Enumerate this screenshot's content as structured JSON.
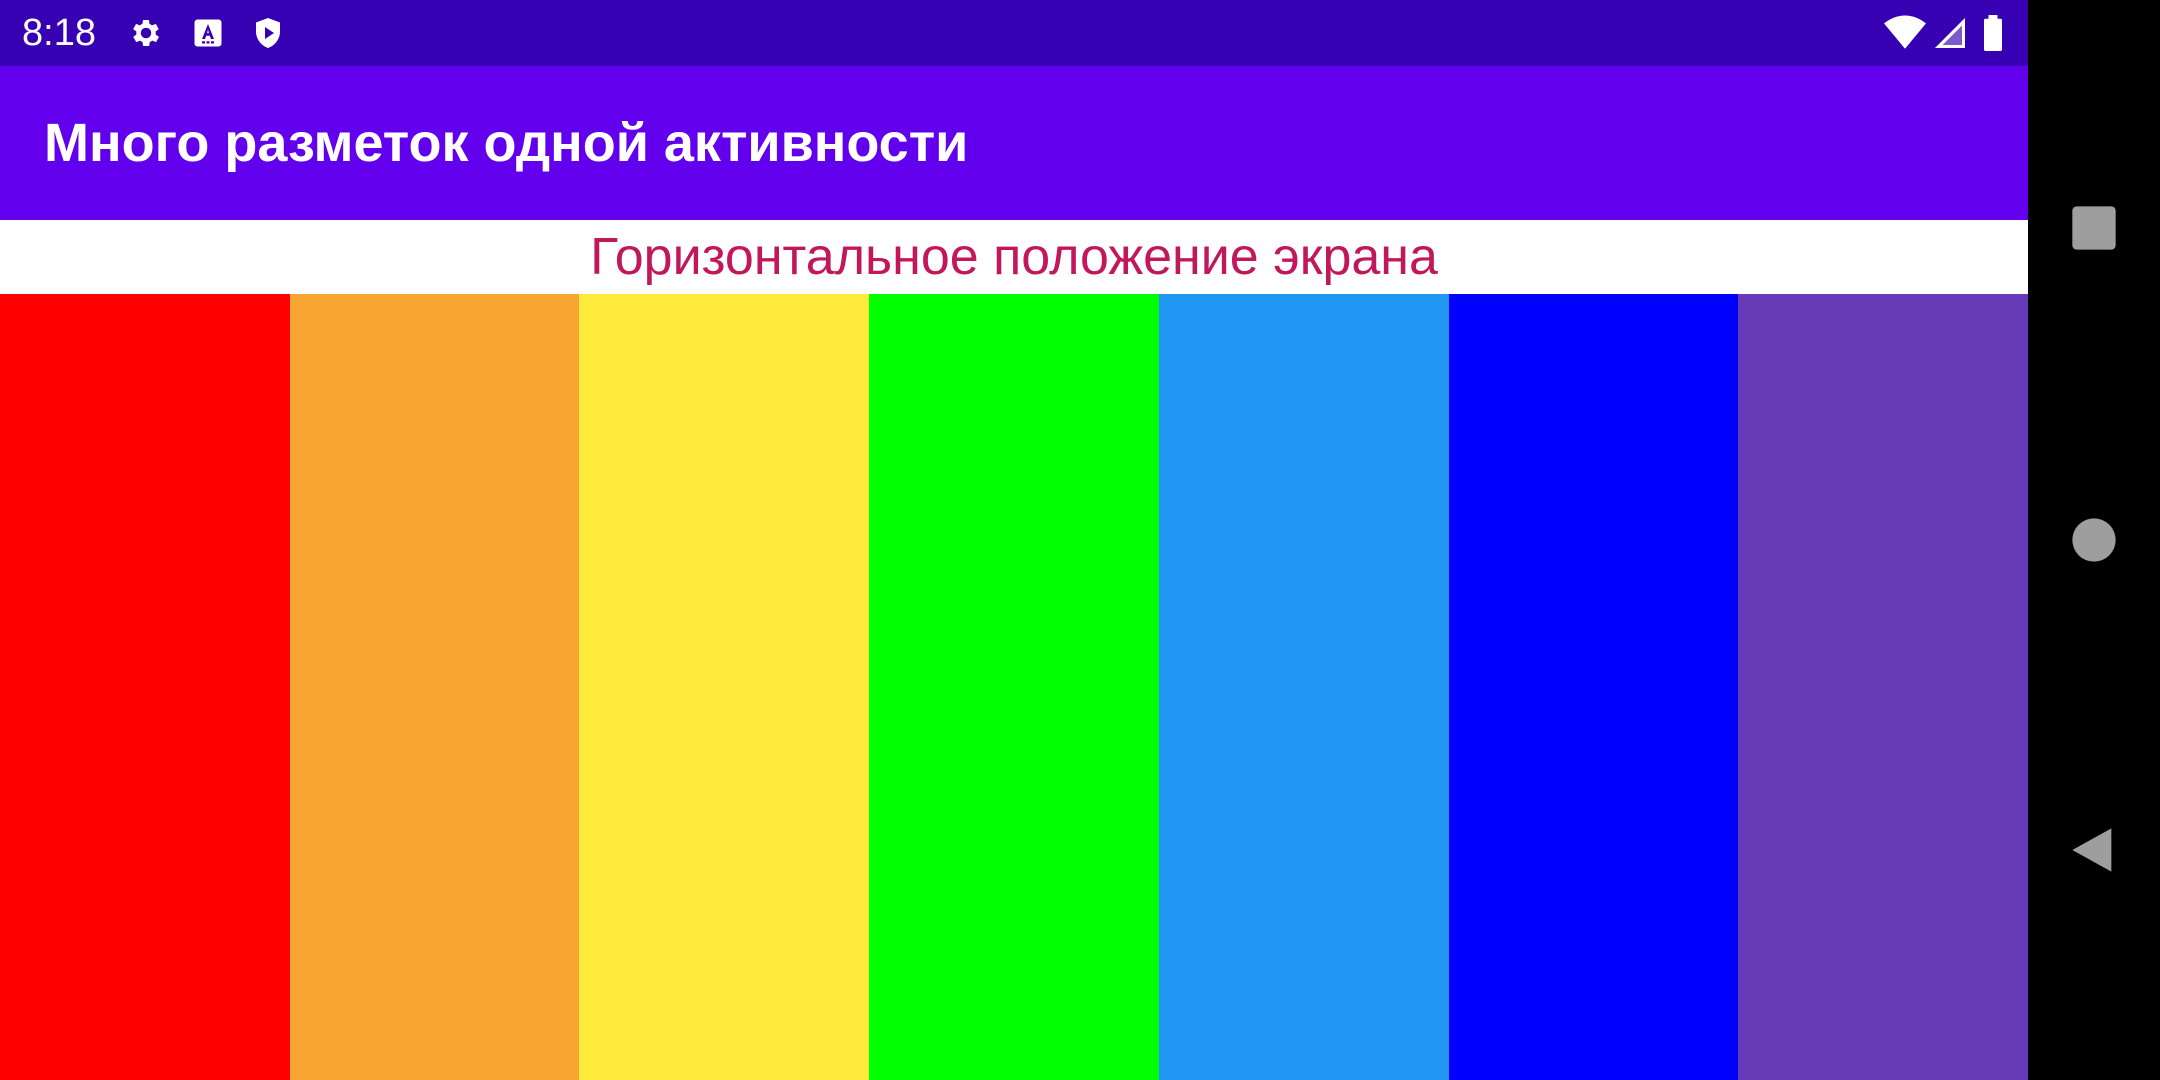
{
  "status_bar": {
    "time": "8:18",
    "background": "#3700b3",
    "icons": [
      "gear-icon",
      "text-a-icon",
      "shield-play-icon",
      "wifi-icon",
      "cell-signal-icon",
      "battery-icon"
    ]
  },
  "app_bar": {
    "title": "Много разметок одной активности",
    "background": "#6200ee"
  },
  "main": {
    "orientation_label": "Горизонтальное положение экрана",
    "label_color": "#c2185b",
    "stripes": [
      {
        "name": "red",
        "color": "#ff0000"
      },
      {
        "name": "orange",
        "color": "#f6a631"
      },
      {
        "name": "yellow",
        "color": "#ffeb3b"
      },
      {
        "name": "green",
        "color": "#00ff00"
      },
      {
        "name": "light-blue",
        "color": "#2196f3"
      },
      {
        "name": "blue",
        "color": "#0000ff"
      },
      {
        "name": "violet",
        "color": "#673ab7"
      }
    ]
  },
  "nav_bar": {
    "buttons": [
      "overview-square-icon",
      "home-circle-icon",
      "back-triangle-icon"
    ]
  }
}
